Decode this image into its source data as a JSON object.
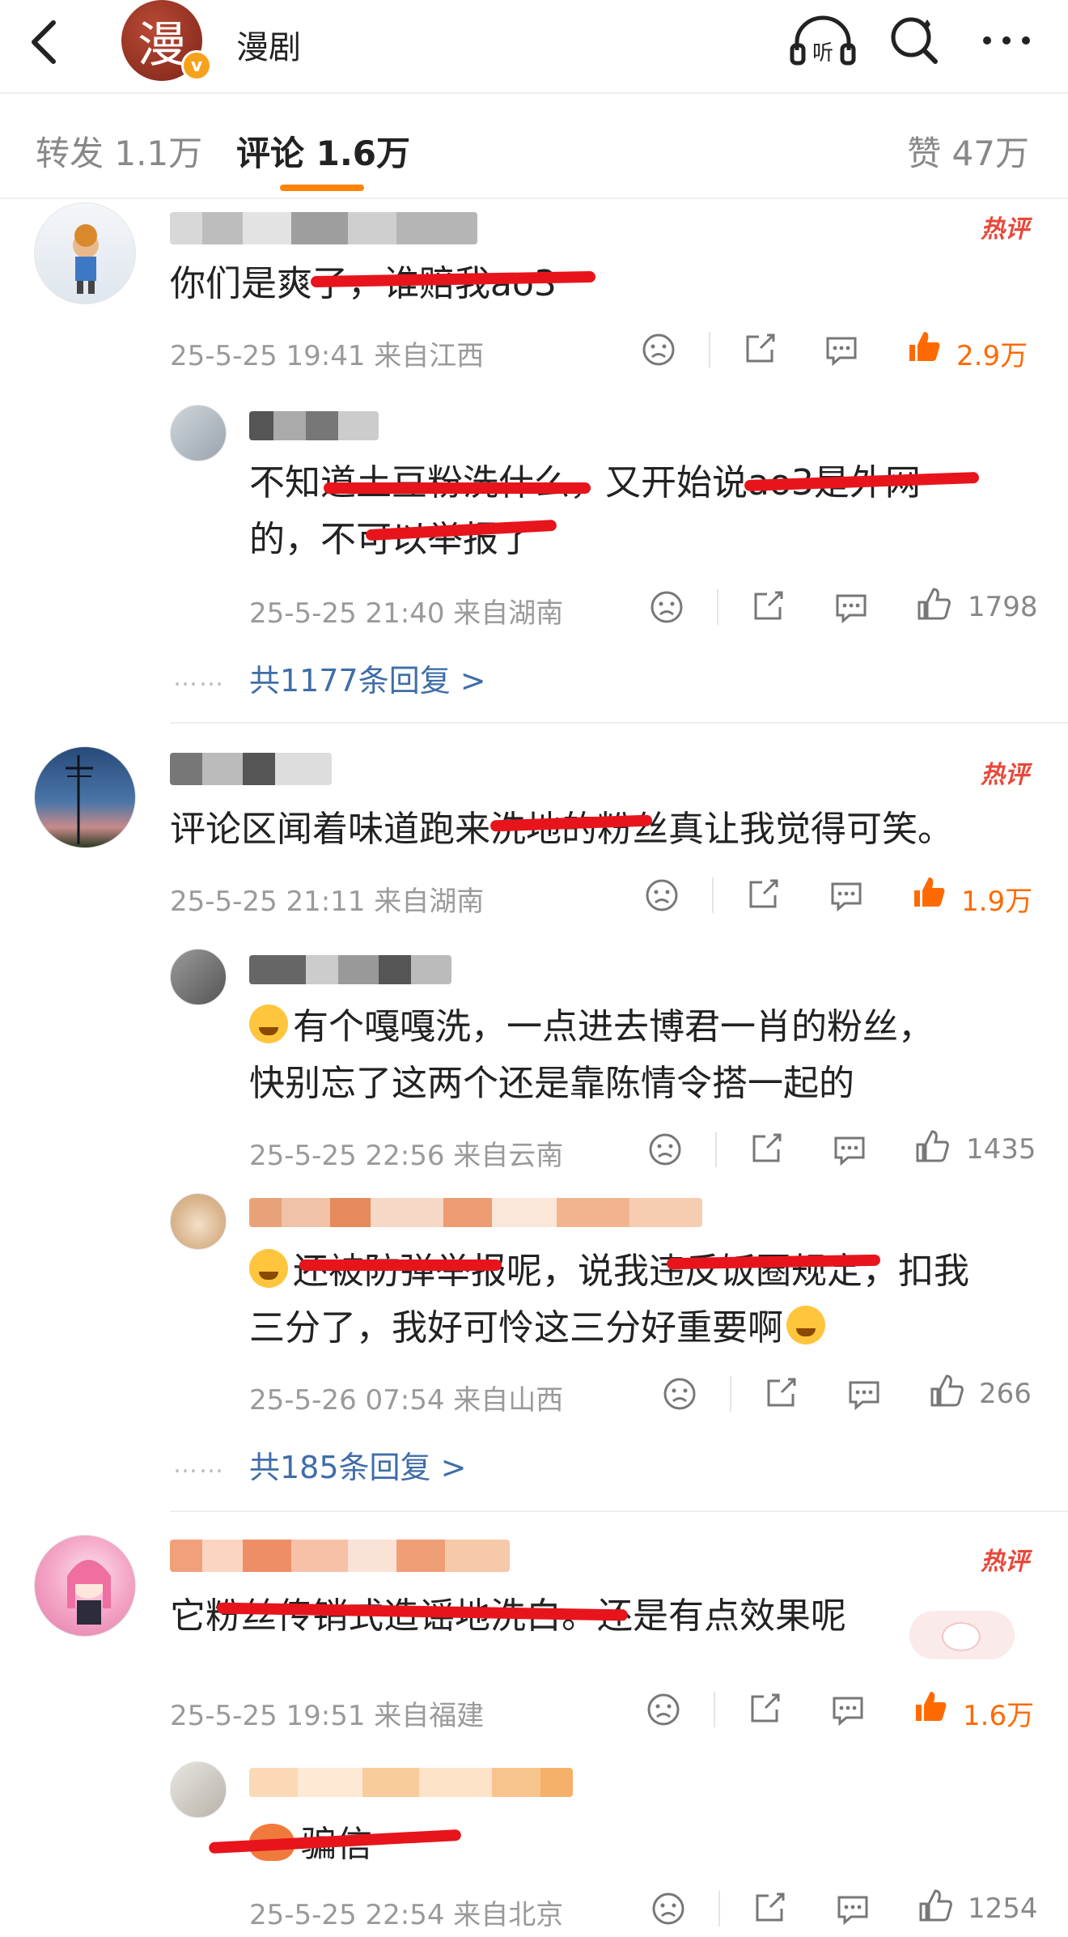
{
  "header": {
    "avatar_char": "漫",
    "badge": "v",
    "title": "漫剧"
  },
  "tabs": {
    "repost": "转发 1.1万",
    "comment": "评论 1.6万",
    "like": "赞 47万"
  },
  "colors": {
    "accent": "#ff8200",
    "hot_like": "#ff6a00",
    "link": "#3f6ea8",
    "redaction": "#e8141c"
  },
  "comments": [
    {
      "hot": "热评",
      "text": "你们是爽了，谁赔我ao3",
      "meta": "25-5-25 19:41 来自江西",
      "likes": "2.9万",
      "replies": [
        {
          "text_line1": "不知道土豆粉洗什么，又开始说ao3是外网",
          "text_line2": "的，不可以举报了",
          "meta": "25-5-25 21:40 来自湖南",
          "likes": "1798"
        }
      ],
      "more_replies": "共1177条回复 >"
    },
    {
      "hot": "热评",
      "text": "评论区闻着味道跑来洗地的粉丝真让我觉得可笑。",
      "meta": "25-5-25 21:11 来自湖南",
      "likes": "1.9万",
      "replies": [
        {
          "text_line1": "有个嘎嘎洗，一点进去博君一肖的粉丝，",
          "text_line2": "快别忘了这两个还是靠陈情令搭一起的",
          "meta": "25-5-25 22:56 来自云南",
          "likes": "1435"
        },
        {
          "text_line1": "还被防弹举报呢，说我违反饭圈规定，扣我",
          "text_line2": "三分了，我好可怜这三分好重要啊",
          "meta": "25-5-26 07:54 来自山西",
          "likes": "266"
        }
      ],
      "more_replies": "共185条回复 >"
    },
    {
      "hot": "热评",
      "text": "它粉丝传销式造谣地洗白。还是有点效果呢",
      "meta": "25-5-25 19:51 来自福建",
      "likes": "1.6万",
      "replies": [
        {
          "text_line1": "骗信",
          "meta": "25-5-25 22:54 来自北京",
          "likes": "1254"
        }
      ]
    }
  ],
  "dots": "……"
}
